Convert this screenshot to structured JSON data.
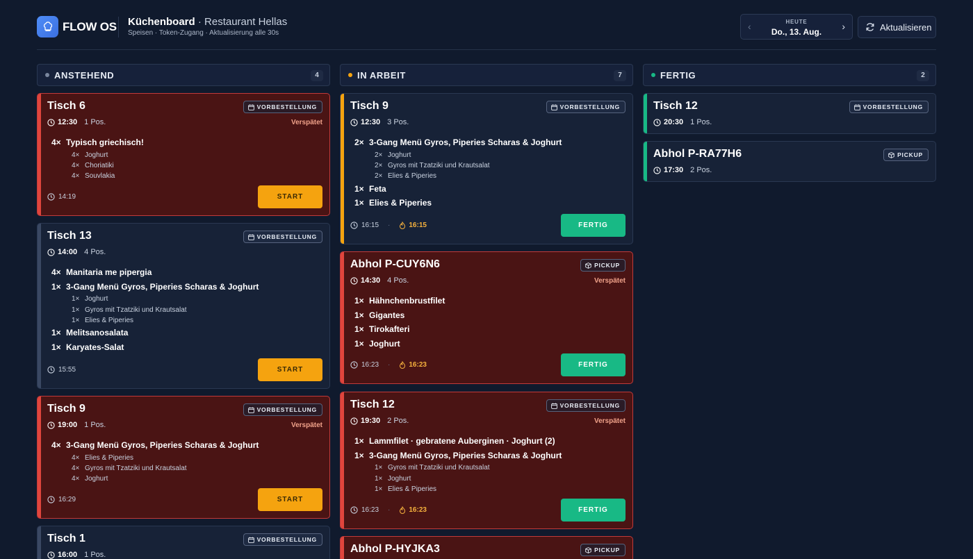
{
  "app": {
    "logo_text": "FLOW OS"
  },
  "header": {
    "board_title": "Küchenboard",
    "restaurant": "· Restaurant Hellas",
    "subtitle": "Speisen · Token-Zugang · Aktualisierung alle 30s",
    "date_label": "HEUTE",
    "date_value": "Do., 13. Aug.",
    "refresh_label": "Aktualisieren"
  },
  "colors": {
    "pending": "#7a879e",
    "in_progress": "#f5a30f",
    "done": "#18b985",
    "late": "#e0453d",
    "start_button": "#f5a30f",
    "done_button": "#18b985"
  },
  "columns": {
    "pending": {
      "title": "ANSTEHEND",
      "count": "4"
    },
    "in_progress": {
      "title": "IN ARBEIT",
      "count": "7"
    },
    "done": {
      "title": "FERTIG",
      "count": "2"
    }
  },
  "labels": {
    "late": "Verspätet",
    "start": "START",
    "done": "FERTIG",
    "preorder": "VORBESTELLUNG",
    "pickup": "PICKUP"
  },
  "cards": {
    "p1": {
      "title": "Tisch 6",
      "time": "12:30",
      "pos": "1 Pos.",
      "foot_time": "14:19",
      "items": [
        {
          "q": "4×",
          "name": "Typisch griechisch!"
        }
      ],
      "subs": [
        {
          "q": "4×",
          "name": "Joghurt"
        },
        {
          "q": "4×",
          "name": "Choriatiki"
        },
        {
          "q": "4×",
          "name": "Souvlakia"
        }
      ]
    },
    "p2": {
      "title": "Tisch 13",
      "time": "14:00",
      "pos": "4 Pos.",
      "foot_time": "15:55",
      "items": [
        {
          "q": "4×",
          "name": "Manitaria me pipergia"
        },
        {
          "q": "1×",
          "name": "3-Gang Menü Gyros, Piperies Scharas & Joghurt"
        },
        {
          "q": "1×",
          "name": "Melitsanosalata"
        },
        {
          "q": "1×",
          "name": "Karyates-Salat"
        }
      ],
      "subs": [
        {
          "q": "1×",
          "name": "Joghurt"
        },
        {
          "q": "1×",
          "name": "Gyros mit Tzatziki und Krautsalat"
        },
        {
          "q": "1×",
          "name": "Elies & Piperies"
        }
      ]
    },
    "p3": {
      "title": "Tisch 9",
      "time": "19:00",
      "pos": "1 Pos.",
      "foot_time": "16:29",
      "items": [
        {
          "q": "4×",
          "name": "3-Gang Menü Gyros, Piperies Scharas & Joghurt"
        }
      ],
      "subs": [
        {
          "q": "4×",
          "name": "Elies & Piperies"
        },
        {
          "q": "4×",
          "name": "Gyros mit Tzatziki und Krautsalat"
        },
        {
          "q": "4×",
          "name": "Joghurt"
        }
      ]
    },
    "p4": {
      "title": "Tisch 1",
      "time": "16:00",
      "pos": "1 Pos."
    },
    "a1": {
      "title": "Tisch 9",
      "time": "12:30",
      "pos": "3 Pos.",
      "foot_time": "16:15",
      "fire_time": "16:15",
      "items": [
        {
          "q": "2×",
          "name": "3-Gang Menü Gyros, Piperies Scharas & Joghurt"
        },
        {
          "q": "1×",
          "name": "Feta"
        },
        {
          "q": "1×",
          "name": "Elies & Piperies"
        }
      ],
      "subs": [
        {
          "q": "2×",
          "name": "Joghurt"
        },
        {
          "q": "2×",
          "name": "Gyros mit Tzatziki und Krautsalat"
        },
        {
          "q": "2×",
          "name": "Elies & Piperies"
        }
      ]
    },
    "a2": {
      "title": "Abhol P-CUY6N6",
      "time": "14:30",
      "pos": "4 Pos.",
      "foot_time": "16:23",
      "fire_time": "16:23",
      "items": [
        {
          "q": "1×",
          "name": "Hähnchenbrustfilet"
        },
        {
          "q": "1×",
          "name": "Gigantes"
        },
        {
          "q": "1×",
          "name": "Tirokafteri"
        },
        {
          "q": "1×",
          "name": "Joghurt"
        }
      ]
    },
    "a3": {
      "title": "Tisch 12",
      "time": "19:30",
      "pos": "2 Pos.",
      "foot_time": "16:23",
      "fire_time": "16:23",
      "items": [
        {
          "q": "1×",
          "name": "Lammfilet · gebratene Auberginen · Joghurt (2)"
        },
        {
          "q": "1×",
          "name": "3-Gang Menü Gyros, Piperies Scharas & Joghurt"
        }
      ],
      "subs": [
        {
          "q": "1×",
          "name": "Gyros mit Tzatziki und Krautsalat"
        },
        {
          "q": "1×",
          "name": "Joghurt"
        },
        {
          "q": "1×",
          "name": "Elies & Piperies"
        }
      ]
    },
    "a4": {
      "title": "Abhol P-HYJKA3"
    },
    "d1": {
      "title": "Tisch 12",
      "time": "20:30",
      "pos": "1 Pos."
    },
    "d2": {
      "title": "Abhol P-RA77H6",
      "time": "17:30",
      "pos": "2 Pos."
    }
  }
}
